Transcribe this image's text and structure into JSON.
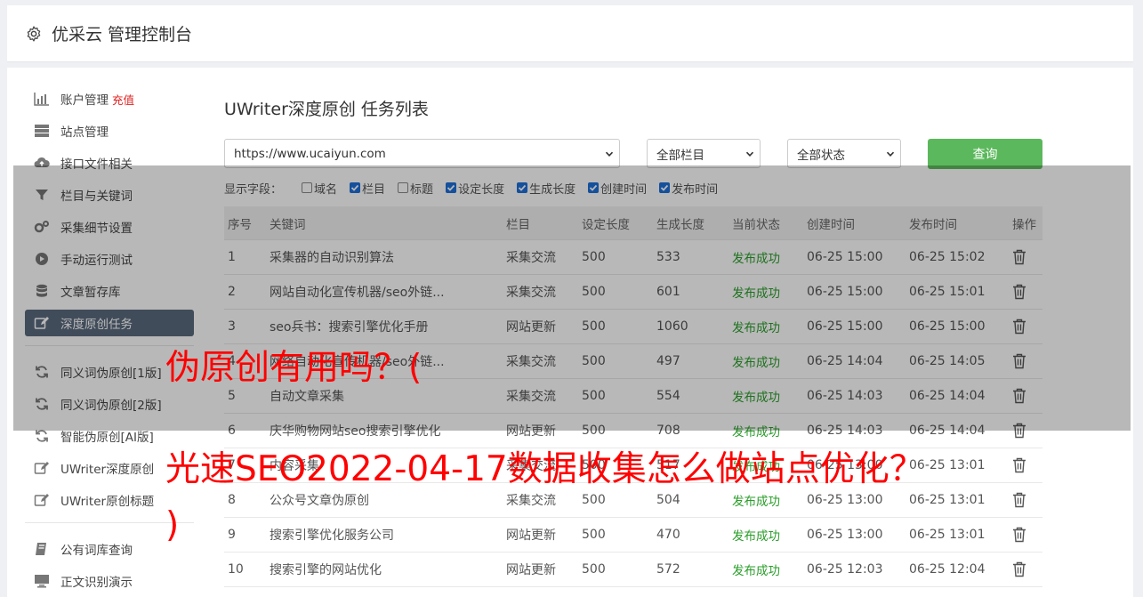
{
  "header": {
    "title": "优采云 管理控制台"
  },
  "sidebar": {
    "groups": [
      [
        {
          "label": "账户管理",
          "icon": "bar-chart-icon",
          "extra": "充值"
        },
        {
          "label": "站点管理",
          "icon": "server-icon"
        },
        {
          "label": "接口文件相关",
          "icon": "cloud-upload-icon"
        },
        {
          "label": "栏目与关键词",
          "icon": "filter-icon"
        },
        {
          "label": "采集细节设置",
          "icon": "gears-icon"
        },
        {
          "label": "手动运行测试",
          "icon": "play-circle-icon"
        },
        {
          "label": "文章暂存库",
          "icon": "database-icon"
        },
        {
          "label": "深度原创任务",
          "icon": "edit-icon",
          "active": true
        }
      ],
      [
        {
          "label": "同义词伪原创[1版]",
          "icon": "refresh-icon"
        },
        {
          "label": "同义词伪原创[2版]",
          "icon": "refresh-icon"
        },
        {
          "label": "智能伪原创[AI版]",
          "icon": "refresh-icon"
        },
        {
          "label": "UWriter深度原创",
          "icon": "edit-icon"
        },
        {
          "label": "UWriter原创标题",
          "icon": "edit-icon"
        }
      ],
      [
        {
          "label": "公有词库查询",
          "icon": "book-icon"
        },
        {
          "label": "正文识别演示",
          "icon": "monitor-icon"
        }
      ]
    ]
  },
  "main": {
    "title": "UWriter深度原创 任务列表",
    "filters": {
      "site": "https://www.ucaiyun.com",
      "column": "全部栏目",
      "status": "全部状态",
      "query_label": "查询"
    },
    "fields": {
      "label": "显示字段：",
      "options": [
        {
          "label": "域名",
          "checked": false
        },
        {
          "label": "栏目",
          "checked": true
        },
        {
          "label": "标题",
          "checked": false
        },
        {
          "label": "设定长度",
          "checked": true
        },
        {
          "label": "生成长度",
          "checked": true
        },
        {
          "label": "创建时间",
          "checked": true
        },
        {
          "label": "发布时间",
          "checked": true
        }
      ]
    },
    "table": {
      "headers": [
        "序号",
        "关键词",
        "栏目",
        "设定长度",
        "生成长度",
        "当前状态",
        "创建时间",
        "发布时间",
        "操作"
      ],
      "rows": [
        [
          "1",
          "采集器的自动识别算法",
          "采集交流",
          "500",
          "533",
          "发布成功",
          "06-25 15:00",
          "06-25 15:02"
        ],
        [
          "2",
          "网站自动化宣传机器/seo外链...",
          "采集交流",
          "500",
          "601",
          "发布成功",
          "06-25 15:00",
          "06-25 15:01"
        ],
        [
          "3",
          "seo兵书：搜索引擎优化手册",
          "网站更新",
          "500",
          "1060",
          "发布成功",
          "06-25 15:00",
          "06-25 15:00"
        ],
        [
          "4",
          "网络自动化宣传机器/seo外链...",
          "采集交流",
          "500",
          "497",
          "发布成功",
          "06-25 14:04",
          "06-25 14:05"
        ],
        [
          "5",
          "自动文章采集",
          "采集交流",
          "500",
          "554",
          "发布成功",
          "06-25 14:03",
          "06-25 14:04"
        ],
        [
          "6",
          "庆华购物网站seo搜索引擎优化",
          "网站更新",
          "500",
          "708",
          "发布成功",
          "06-25 14:03",
          "06-25 14:04"
        ],
        [
          "7",
          "内容采集",
          "采集交流",
          "500",
          "517",
          "发布成功",
          "06-25 13:00",
          "06-25 13:01"
        ],
        [
          "8",
          "公众号文章伪原创",
          "采集交流",
          "500",
          "504",
          "发布成功",
          "06-25 13:00",
          "06-25 13:01"
        ],
        [
          "9",
          "搜索引擎优化服务公司",
          "网站更新",
          "500",
          "470",
          "发布成功",
          "06-25 13:00",
          "06-25 13:01"
        ],
        [
          "10",
          "搜索引擎的网站优化",
          "网站更新",
          "500",
          "572",
          "发布成功",
          "06-25 12:03",
          "06-25 12:04"
        ]
      ]
    }
  },
  "watermark": {
    "line1": "伪原创有用吗？(",
    "line2": "光速SEO2022-04-17数据收集怎么做站点优化？",
    "line3": ")"
  },
  "colors": {
    "accent_green": "#5cb85c",
    "status_green": "#2a9d2a",
    "active_nav": "#5b6a7e",
    "watermark_red": "#ff0000"
  }
}
